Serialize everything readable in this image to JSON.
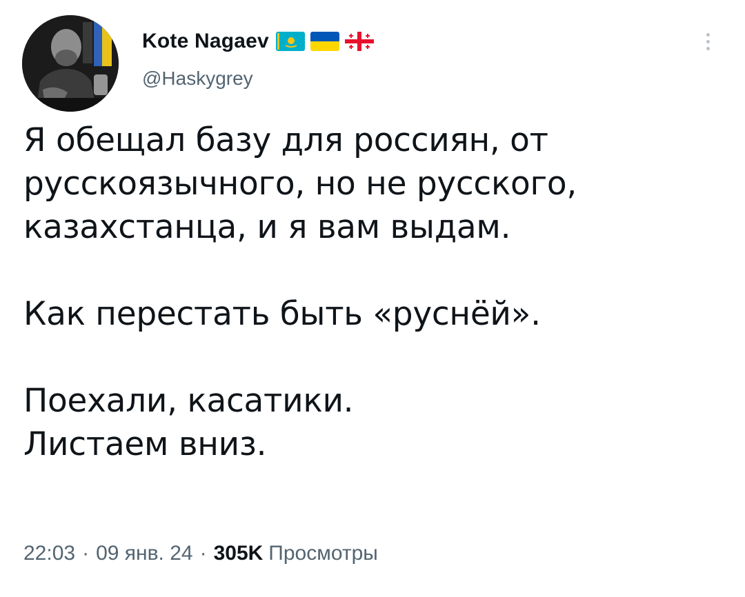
{
  "tweet": {
    "author": {
      "display_name": "Kote Nagaev",
      "handle": "@Haskygrey",
      "flags": [
        "kazakhstan-flag",
        "ukraine-flag",
        "georgia-flag"
      ]
    },
    "text": "Я обещал базу для россиян, от\nрусскоязычного, но не русского,\nказахстанца, и я вам выдам.\n\nКак перестать быть «руснёй».\n\nПоехали, касатики.\nЛистаем вниз.",
    "time": "22:03",
    "date": "09 янв. 24",
    "separator": "·",
    "views_count": "305K",
    "views_label": "Просмотры"
  },
  "colors": {
    "text_primary": "#0f1419",
    "text_secondary": "#536471",
    "kz_blue": "#00afca",
    "kz_gold": "#fec50c",
    "ua_blue": "#0057b7",
    "ua_yellow": "#ffd700",
    "ge_red": "#e8112d"
  }
}
